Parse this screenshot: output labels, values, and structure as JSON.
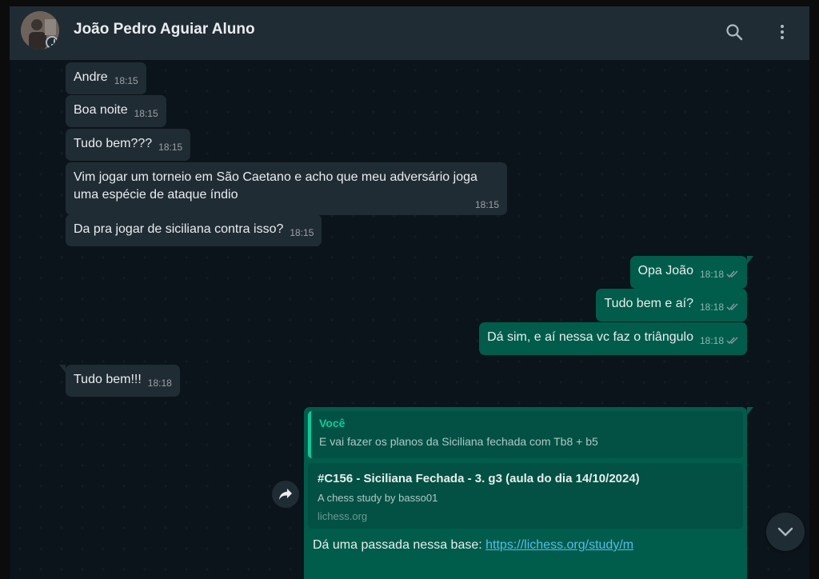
{
  "header": {
    "contact_name": "João Pedro Aguiar Aluno",
    "icons": [
      "search-icon",
      "kebab-menu-icon"
    ]
  },
  "messages": [
    {
      "direction": "in",
      "text": "Andre",
      "time": "18:15"
    },
    {
      "direction": "in",
      "text": "Boa noite",
      "time": "18:15"
    },
    {
      "direction": "in",
      "text": "Tudo bem???",
      "time": "18:15"
    },
    {
      "direction": "in",
      "text_line1": "Vim jogar um torneio em São Caetano e acho que meu adversário joga",
      "text_line2": "uma espécie de ataque índio",
      "time": "18:15"
    },
    {
      "direction": "in",
      "text": "Da pra jogar de siciliana contra isso?",
      "time": "18:15"
    },
    {
      "direction": "out",
      "text": "Opa João",
      "time": "18:18",
      "status": "read"
    },
    {
      "direction": "out",
      "text": "Tudo bem e aí?",
      "time": "18:18",
      "status": "read"
    },
    {
      "direction": "out",
      "text": "Dá sim, e aí nessa vc faz o triângulo",
      "time": "18:18",
      "status": "read"
    },
    {
      "direction": "in",
      "text": "Tudo bem!!!",
      "time": "18:18"
    }
  ],
  "rich_message": {
    "quote_author": "Você",
    "quote_text": "E vai fazer os planos da Siciliana fechada com Tb8 + b5",
    "preview_title": "#C156 - Siciliana Fechada - 3. g3 (aula do dia 14/10/2024)",
    "preview_description": "A chess study by basso01",
    "preview_domain": "lichess.org",
    "body_text": "Dá uma passada nessa base: ",
    "link_text": "https://lichess.org/study/m"
  },
  "colors": {
    "incoming_bubble": "#202c33",
    "outgoing_bubble": "#005c4b",
    "accent": "#06cf9c",
    "link": "#53bdeb",
    "read_ticks": "#8696a0"
  }
}
